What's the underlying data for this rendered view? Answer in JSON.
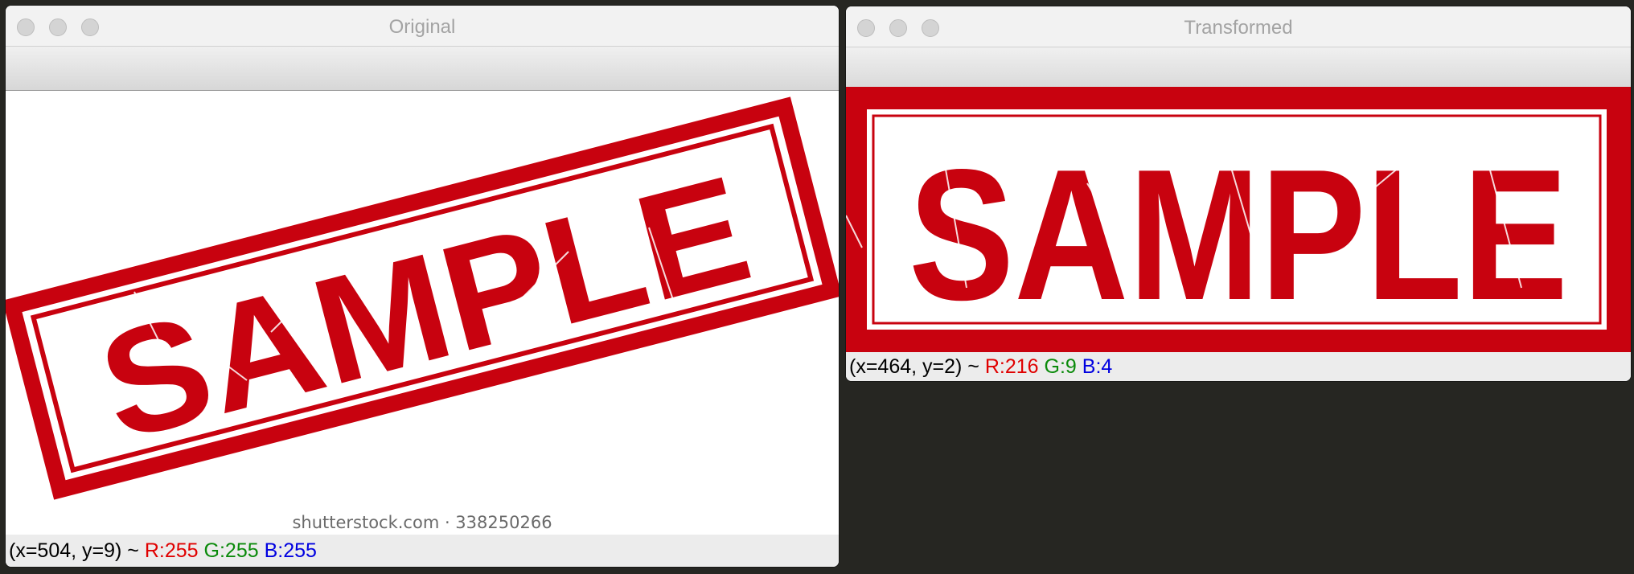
{
  "windows": [
    {
      "title": "Original",
      "image": {
        "stamp_text": "SAMPLE",
        "watermark": "shutterstock.com · 338250266"
      },
      "status": {
        "coords": "(x=504, y=9) ~ ",
        "r": "R:255",
        "g": "G:255",
        "b": "B:255"
      }
    },
    {
      "title": "Transformed",
      "image": {
        "stamp_text": "SAMPLE"
      },
      "status": {
        "coords": "(x=464, y=2) ~ ",
        "r": "R:216",
        "g": "G:9",
        "b": "B:4"
      }
    }
  ],
  "colors": {
    "stamp_red": "#c8020f",
    "desktop": "#262622",
    "r_label": "#e00000",
    "g_label": "#0a8a0a",
    "b_label": "#0000e0"
  }
}
